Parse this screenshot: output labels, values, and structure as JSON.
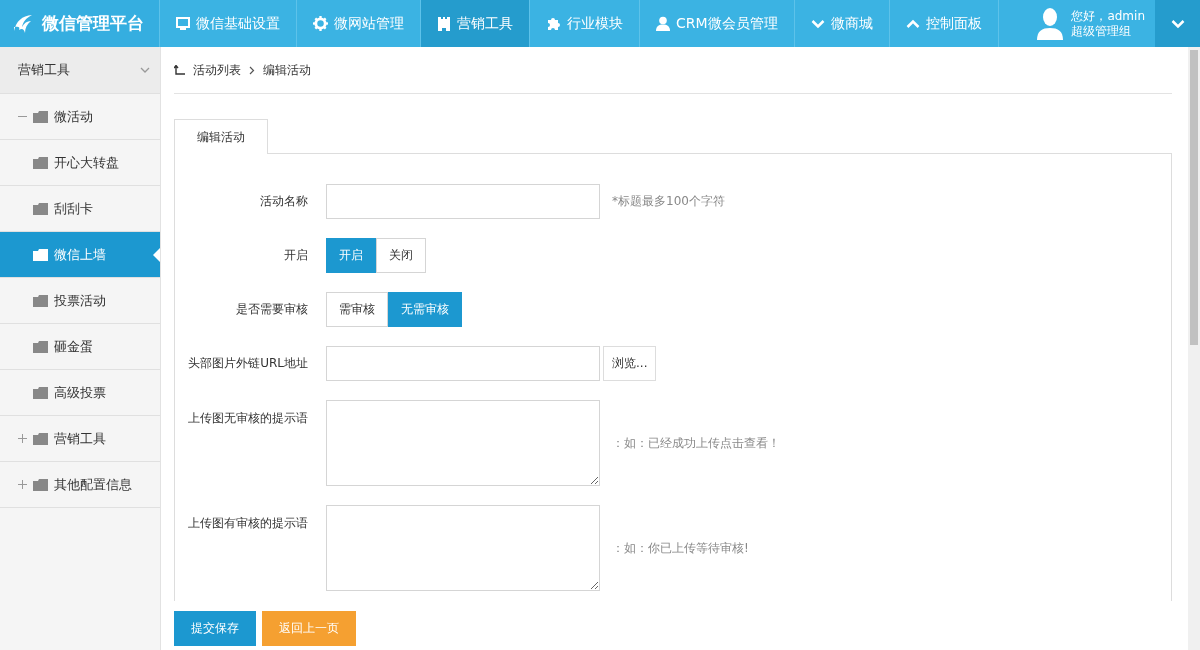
{
  "header": {
    "logo": "微信管理平台",
    "nav": [
      {
        "label": "微信基础设置",
        "selected": false
      },
      {
        "label": "微网站管理",
        "selected": false
      },
      {
        "label": "营销工具",
        "selected": true
      },
      {
        "label": "行业模块",
        "selected": false
      },
      {
        "label": "CRM微会员管理",
        "selected": false
      },
      {
        "label": "微商城",
        "selected": false
      },
      {
        "label": "控制面板",
        "selected": false
      }
    ],
    "user": {
      "greeting": "您好，admin",
      "role": "超级管理组"
    }
  },
  "sidebar": {
    "title": "营销工具",
    "items": [
      {
        "label": "微活动",
        "expanded": true,
        "children": [
          {
            "label": "开心大转盘",
            "selected": false
          },
          {
            "label": "刮刮卡",
            "selected": false
          },
          {
            "label": "微信上墙",
            "selected": true
          },
          {
            "label": "投票活动",
            "selected": false
          },
          {
            "label": "砸金蛋",
            "selected": false
          },
          {
            "label": "高级投票",
            "selected": false
          }
        ]
      },
      {
        "label": "营销工具",
        "expanded": false
      },
      {
        "label": "其他配置信息",
        "expanded": false
      }
    ]
  },
  "breadcrumb": [
    "活动列表",
    "编辑活动"
  ],
  "tabs": [
    {
      "label": "编辑活动",
      "selected": true
    }
  ],
  "form": {
    "fields": [
      {
        "kind": "text",
        "label": "活动名称",
        "hint": "*标题最多100个字符"
      },
      {
        "kind": "choice",
        "label": "开启",
        "options": [
          {
            "label": "开启",
            "selected": true
          },
          {
            "label": "关闭",
            "selected": false
          }
        ]
      },
      {
        "kind": "choice",
        "label": "是否需要审核",
        "options": [
          {
            "label": "需审核",
            "selected": false
          },
          {
            "label": "无需审核",
            "selected": true
          }
        ]
      },
      {
        "kind": "file",
        "label": "头部图片外链URL地址",
        "button": "浏览..."
      },
      {
        "kind": "textarea",
        "label": "上传图无审核的提示语",
        "hint": "：如：已经成功上传点击查看！"
      },
      {
        "kind": "textarea",
        "label": "上传图有审核的提示语",
        "hint": "：如：你已上传等待审核!"
      }
    ]
  },
  "buttons": [
    {
      "label": "提交保存",
      "kind": "primary"
    },
    {
      "label": "返回上一页",
      "kind": "secondary"
    }
  ]
}
